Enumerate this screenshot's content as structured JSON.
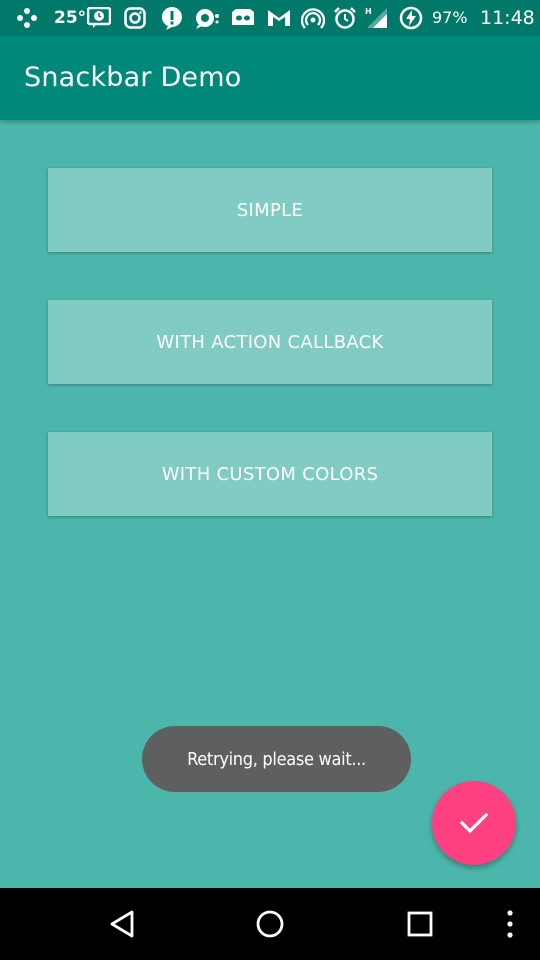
{
  "status_bar": {
    "temperature": "25°",
    "battery_percent": "97%",
    "time": "11:48",
    "icons": [
      "game-controller-icon",
      "clock-message-icon",
      "instagram-icon",
      "alert-icon",
      "chat-icon",
      "cyanogen-robot-icon",
      "gmail-icon",
      "wifi-hotspot-icon",
      "alarm-icon",
      "signal-icon",
      "battery-charging-icon"
    ]
  },
  "app_bar": {
    "title": "Snackbar Demo"
  },
  "buttons": {
    "simple": "SIMPLE",
    "action_callback": "WITH ACTION CALLBACK",
    "custom_colors": "WITH CUSTOM COLORS"
  },
  "toast": {
    "message": "Retrying, please wait..."
  },
  "fab": {
    "icon": "checkmark-icon"
  },
  "nav_bar": {
    "icons": [
      "back-icon",
      "home-icon",
      "recents-icon",
      "menu-icon"
    ]
  },
  "colors": {
    "status_bar": "#00796b",
    "app_bar": "#00897b",
    "background": "#4db6ac",
    "button": "#80cbc4",
    "fab": "#ff4081",
    "toast": "#5d605f"
  }
}
